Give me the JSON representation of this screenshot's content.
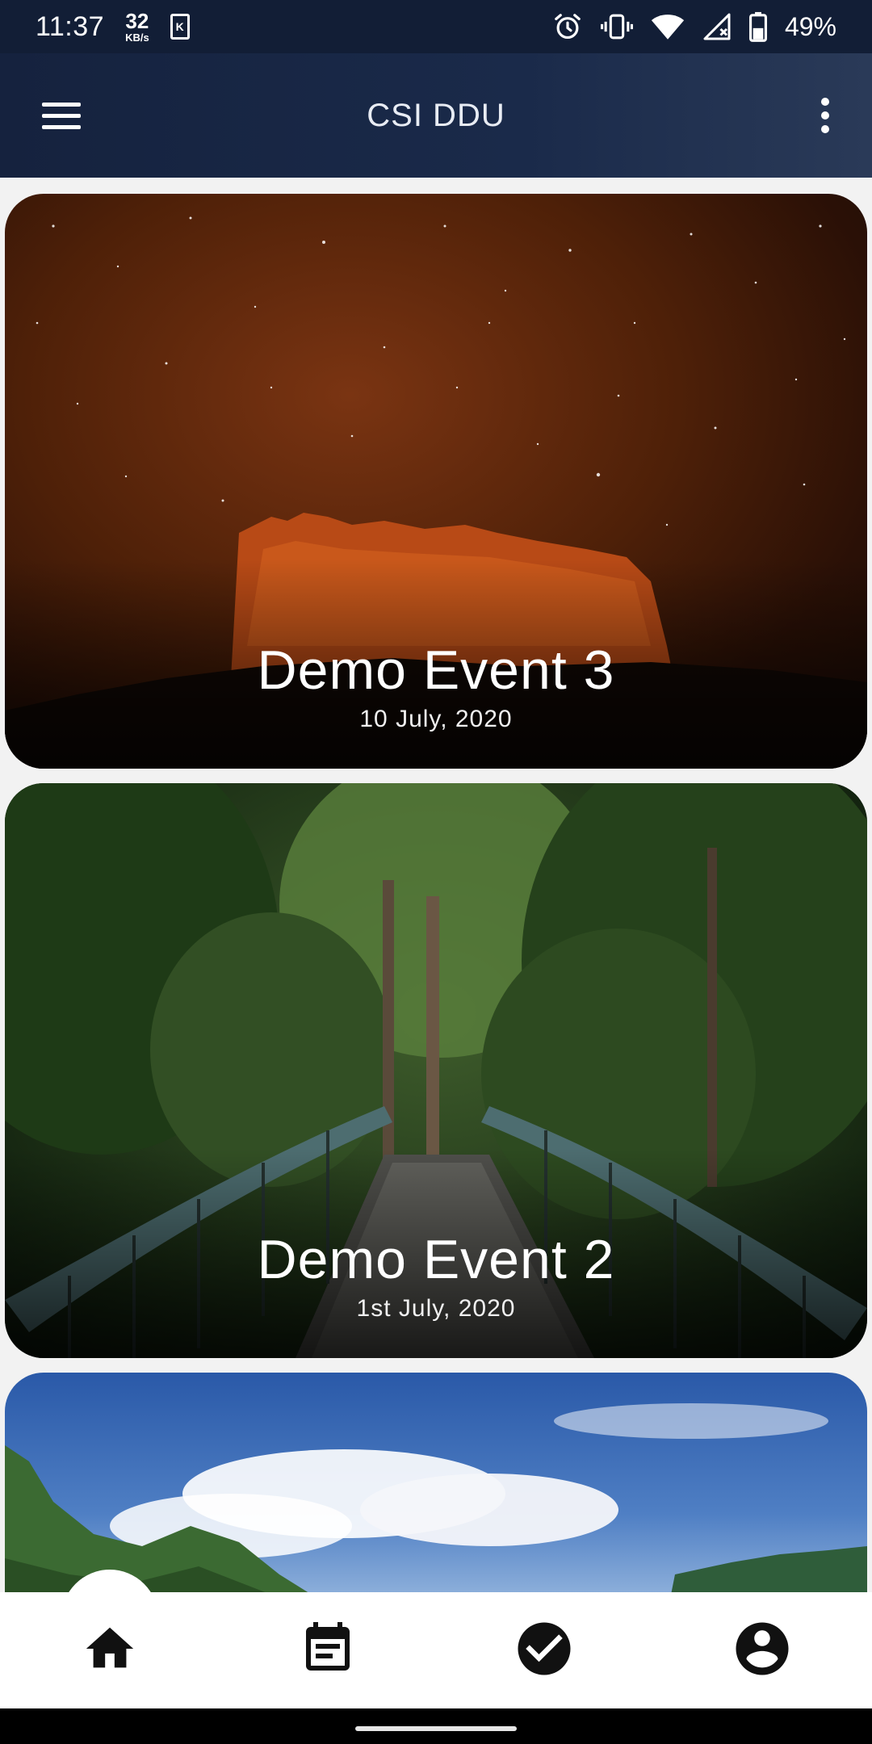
{
  "status_bar": {
    "time": "11:37",
    "speed_value": "32",
    "speed_unit": "KB/s",
    "notification_icon": "k-icon",
    "icons": [
      "alarm-icon",
      "vibrate-icon",
      "wifi-icon",
      "signal-no-data-icon",
      "battery-icon"
    ],
    "battery_percent": "49%",
    "battery_level": 0.49
  },
  "app_bar": {
    "title": "CSI DDU",
    "menu_icon": "hamburger-menu-icon",
    "overflow_icon": "more-vertical-icon"
  },
  "events": [
    {
      "title": "Demo Event 3",
      "date": "10 July, 2020",
      "image": "red-mesa-under-starry-sky"
    },
    {
      "title": "Demo Event 2",
      "date": "1st July, 2020",
      "image": "footbridge-in-forest"
    },
    {
      "title": "",
      "date": "",
      "image": "mountains-under-blue-sky"
    }
  ],
  "bottom_nav": {
    "items": [
      {
        "name": "home",
        "icon": "home-icon",
        "active": true
      },
      {
        "name": "events",
        "icon": "event-note-icon",
        "active": false
      },
      {
        "name": "tasks",
        "icon": "check-circle-icon",
        "active": false
      },
      {
        "name": "profile",
        "icon": "account-circle-icon",
        "active": false
      }
    ]
  },
  "colors": {
    "status_bar": "#121e36",
    "app_bar": "#1a2a4a",
    "background": "#f2f2f2",
    "nav_background": "#ffffff",
    "icon_dark": "#111111"
  }
}
